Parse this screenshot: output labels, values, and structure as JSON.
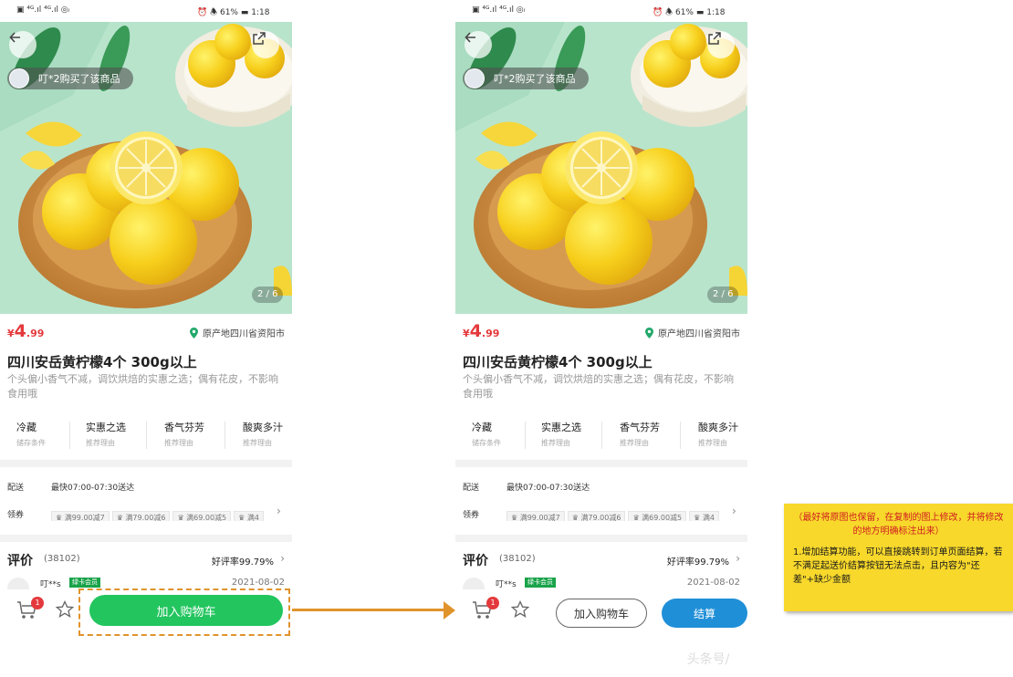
{
  "screens": {
    "left": {
      "status": {
        "left": "▣ ⁴ᴳ.ıl ⁴ᴳ.ıl ◎ᵢ",
        "right": "⏰ 🕭 61% ▬ 1:18"
      },
      "buyer_banner": "叮*2购买了该商品",
      "image_counter": "2 / 6",
      "price": {
        "currency": "¥",
        "integer": "4",
        "decimal": ".99"
      },
      "origin": "原产地四川省资阳市",
      "title": "四川安岳黄柠檬4个 300g以上",
      "subtitle": "个头偏小香气不减，调饮烘焙的实惠之选；偶有花皮，不影响食用哦",
      "tags": [
        {
          "name": "冷藏",
          "desc": "储存条件"
        },
        {
          "name": "实惠之选",
          "desc": "推荐理由"
        },
        {
          "name": "香气芬芳",
          "desc": "推荐理由"
        },
        {
          "name": "酸爽多汁",
          "desc": "推荐理由"
        }
      ],
      "delivery": {
        "label": "配送",
        "value": "最快07:00-07:30送达"
      },
      "coupons": {
        "label": "领券",
        "items": [
          "满99.00减7",
          "满79.00减6",
          "满69.00减5",
          "满4"
        ]
      },
      "reviews": {
        "title": "评价",
        "count": "(38102)",
        "rate": "好评率99.79%",
        "user": "叮**s",
        "badge": "绿卡会员",
        "date": "2021-08-02"
      },
      "bottom": {
        "cart_count": "1",
        "add_to_cart": "加入购物车"
      }
    },
    "right": {
      "status": {
        "left": "▣ ⁴ᴳ.ıl ⁴ᴳ.ıl ◎ᵢ",
        "right": "⏰ 🕭 61% ▬ 1:18"
      },
      "buyer_banner": "叮*2购买了该商品",
      "image_counter": "2 / 6",
      "price": {
        "currency": "¥",
        "integer": "4",
        "decimal": ".99"
      },
      "origin": "原产地四川省资阳市",
      "title": "四川安岳黄柠檬4个 300g以上",
      "subtitle": "个头偏小香气不减，调饮烘焙的实惠之选；偶有花皮，不影响食用哦",
      "tags": [
        {
          "name": "冷藏",
          "desc": "储存条件"
        },
        {
          "name": "实惠之选",
          "desc": "推荐理由"
        },
        {
          "name": "香气芬芳",
          "desc": "推荐理由"
        },
        {
          "name": "酸爽多汁",
          "desc": "推荐理由"
        }
      ],
      "delivery": {
        "label": "配送",
        "value": "最快07:00-07:30送达"
      },
      "coupons": {
        "label": "领券",
        "items": [
          "满99.00减7",
          "满79.00减6",
          "满69.00减5",
          "满4"
        ]
      },
      "reviews": {
        "title": "评价",
        "count": "(38102)",
        "rate": "好评率99.79%",
        "user": "叮**s",
        "badge": "绿卡会员",
        "date": "2021-08-02"
      },
      "bottom": {
        "cart_count": "1",
        "add_to_cart": "加入购物车",
        "checkout": "结算"
      }
    }
  },
  "annotation": {
    "line1": "（最好将原图也保留，在复制的图上修改，并将修改的地方明确标注出来）",
    "line2": "1.增加结算功能，可以直接跳转到订单页面结算，若不满足起送价结算按钮无法点击，且内容为\"还差\"+缺少金额"
  },
  "watermark": "头条号/",
  "colors": {
    "price": "#e4393c",
    "add_button": "#22c55e",
    "checkout": "#1f8fd8",
    "highlight": "#e0932b",
    "note_bg": "#f7d82b",
    "note_red": "#d02020"
  },
  "icons": [
    "back-icon",
    "share-icon",
    "location-pin-icon",
    "cart-icon",
    "star-icon",
    "chevron-right-icon",
    "crown-icon"
  ]
}
